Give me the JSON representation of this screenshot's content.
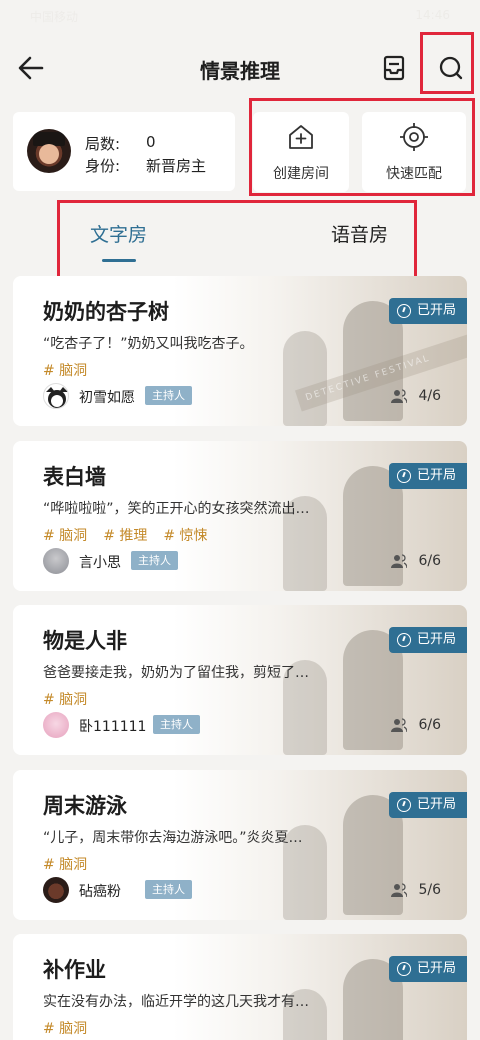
{
  "status_bar": {
    "left": "中国移动",
    "right": "14:46"
  },
  "header": {
    "title": "情景推理"
  },
  "profile": {
    "rounds_label": "局数:",
    "rounds_value": "0",
    "identity_label": "身份:",
    "identity_value": "新晋房主"
  },
  "actions": {
    "create_room": "创建房间",
    "quick_match": "快速匹配"
  },
  "tabs": [
    {
      "label": "文字房",
      "active": true
    },
    {
      "label": "语音房",
      "active": false
    }
  ],
  "rooms": [
    {
      "title": "奶奶的杏子树",
      "desc": "“吃杏子了！”奶奶又叫我吃杏子。",
      "tags": [
        "# 脑洞"
      ],
      "host": "初雪如愿",
      "host_badge": "主持人",
      "status": "已开局",
      "players": "4/6"
    },
    {
      "title": "表白墙",
      "desc": "“哗啦啦啦”，笑的正开心的女孩突然流出…",
      "tags": [
        "# 脑洞",
        "# 推理",
        "# 惊悚"
      ],
      "host": "言小思",
      "host_badge": "主持人",
      "status": "已开局",
      "players": "6/6"
    },
    {
      "title": "物是人非",
      "desc": "爸爸要接走我，奶奶为了留住我，剪短了…",
      "tags": [
        "# 脑洞"
      ],
      "host": "卧111111",
      "host_badge": "主持人",
      "status": "已开局",
      "players": "6/6"
    },
    {
      "title": "周末游泳",
      "desc": "“儿子，周末带你去海边游泳吧。”炎炎夏…",
      "tags": [
        "# 脑洞"
      ],
      "host": "砧癌粉",
      "host_badge": "主持人",
      "status": "已开局",
      "players": "5/6"
    },
    {
      "title": "补作业",
      "desc": "实在没有办法，临近开学的这几天我才有…",
      "tags": [
        "# 脑洞"
      ],
      "host": "",
      "host_badge": "",
      "status": "已开局",
      "players": ""
    }
  ],
  "background_text": "DETECTIVE FESTIVAL",
  "colors": {
    "accent": "#2f6f93",
    "tag": "#c48a2a",
    "highlight_box": "#e0263b",
    "badge": "#8fb1c8"
  }
}
